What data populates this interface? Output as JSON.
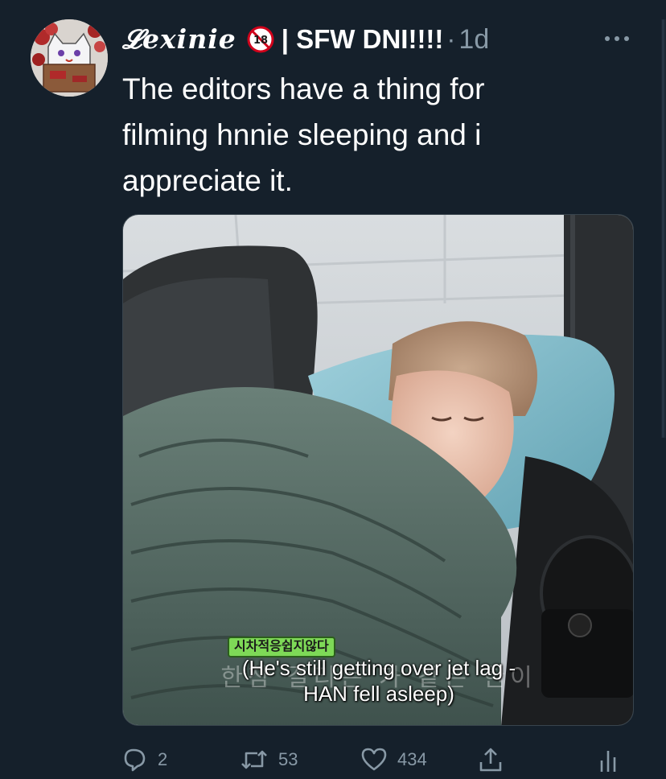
{
  "tweet": {
    "display_name": "𝓛exinie",
    "name_badge_icon": "no-under-18-icon",
    "name_suffix": "| SFW DNI!!!!",
    "separator": "·",
    "timestamp": "1d",
    "text": "The editors have a thing for filming hnnie sleeping and i appreciate it.",
    "media": {
      "subtitle_tag": "시차적응쉽지않다",
      "subtitle_ghost": "한참 걸리는 가 같은 한이",
      "subtitle_line1": "(He's still getting over jet lag -",
      "subtitle_line2": "HAN fell asleep)"
    },
    "actions": {
      "reply_count": "2",
      "retweet_count": "53",
      "like_count": "434"
    },
    "icons": {
      "more": "more-dots-icon",
      "reply": "reply-bubble-icon",
      "retweet": "retweet-icon",
      "like": "heart-icon",
      "share": "share-icon",
      "analytics": "analytics-icon"
    },
    "colors": {
      "background": "#15202b",
      "secondary_text": "#8899a6",
      "primary_text": "#ffffff"
    }
  }
}
